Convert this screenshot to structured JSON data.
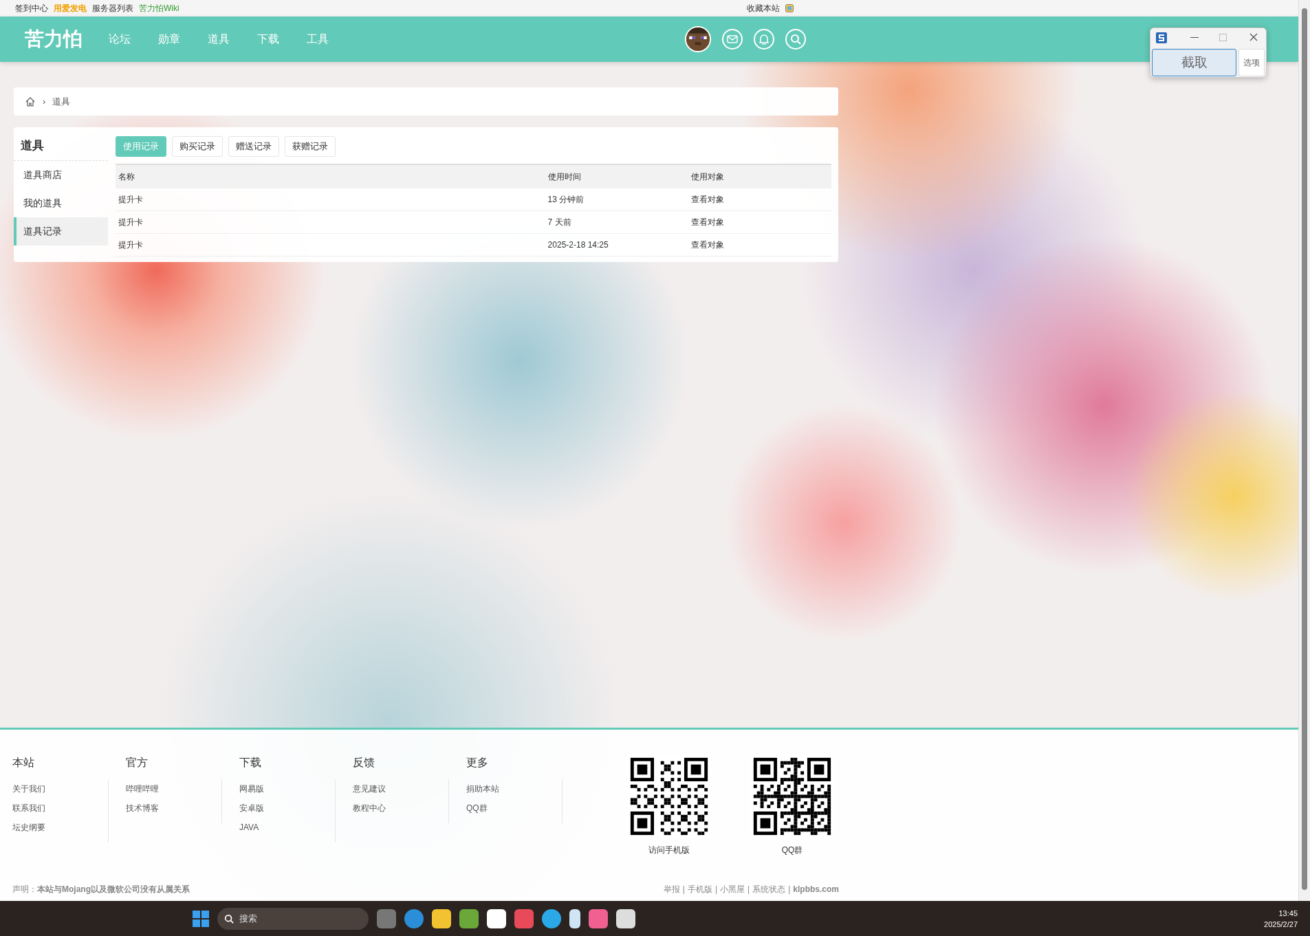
{
  "top_bar": {
    "links": [
      {
        "text": "签到中心",
        "kind": "plain"
      },
      {
        "text": "用爱发电",
        "kind": "sponsor"
      },
      {
        "text": "服务器列表",
        "kind": "plain"
      },
      {
        "text": "苦力怕Wiki",
        "kind": "wiki"
      }
    ],
    "bookmark": "收藏本站"
  },
  "header": {
    "logo": "苦力怕",
    "nav": [
      "论坛",
      "勋章",
      "道具",
      "下载",
      "工具"
    ]
  },
  "breadcrumb": {
    "separator": "›",
    "items": [
      "道具"
    ]
  },
  "sidebar": {
    "title": "道具",
    "items": [
      {
        "label": "道具商店",
        "selected": false
      },
      {
        "label": "我的道具",
        "selected": false
      },
      {
        "label": "道具记录",
        "selected": true
      }
    ]
  },
  "tabs": [
    {
      "label": "使用记录",
      "selected": true
    },
    {
      "label": "购买记录",
      "selected": false
    },
    {
      "label": "赠送记录",
      "selected": false
    },
    {
      "label": "获赠记录",
      "selected": false
    }
  ],
  "table": {
    "columns": [
      "名称",
      "使用时间",
      "使用对象"
    ],
    "rows": [
      [
        "提升卡",
        "13 分钟前",
        "查看对象"
      ],
      [
        "提升卡",
        "7 天前",
        "查看对象"
      ],
      [
        "提升卡",
        "2025-2-18 14:25",
        "查看对象"
      ]
    ]
  },
  "footer": {
    "columns": [
      {
        "title": "本站",
        "links": [
          "关于我们",
          "联系我们",
          "坛史纲要"
        ]
      },
      {
        "title": "官方",
        "links": [
          "哔哩哔哩",
          "技术博客"
        ]
      },
      {
        "title": "下载",
        "links": [
          "网易版",
          "安卓版",
          "JAVA"
        ]
      },
      {
        "title": "反馈",
        "links": [
          "意见建议",
          "教程中心"
        ]
      },
      {
        "title": "更多",
        "links": [
          "捐助本站",
          "QQ群"
        ]
      }
    ],
    "qr_codes": [
      {
        "caption": "访问手机版"
      },
      {
        "caption": "QQ群"
      }
    ],
    "disclaimer": "声明：**本站与Mojang以及微软公司没有从属关系**",
    "link_separator": "|",
    "links": [
      {
        "text": "举报",
        "bold": false
      },
      {
        "text": "手机版",
        "bold": false
      },
      {
        "text": "小黑屋",
        "bold": false
      },
      {
        "text": "系统状态",
        "bold": false
      },
      {
        "text": "klpbbs.com",
        "bold": true
      }
    ]
  },
  "snip_window": {
    "primary_button": "截取",
    "options_button": "选项"
  },
  "taskbar": {
    "search_placeholder": "搜索",
    "time": "13:45",
    "date": "2025/2/27"
  }
}
